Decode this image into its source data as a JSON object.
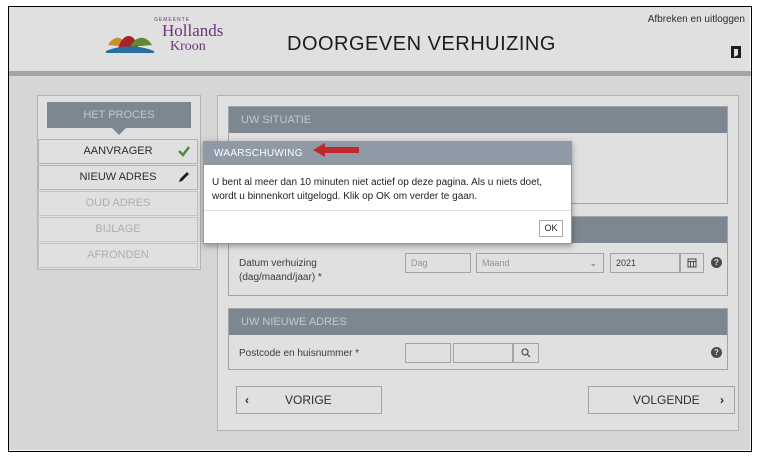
{
  "header": {
    "logo_top": "GEMEENTE",
    "logo_line1": "Hollands",
    "logo_line2": "Kroon",
    "title": "DOORGEVEN VERHUIZING",
    "logout": "Afbreken en uitloggen",
    "logout_icon": "door-exit-icon"
  },
  "sidebar": {
    "heading": "HET PROCES",
    "steps": [
      {
        "label": "AANVRAGER",
        "state": "done",
        "icon": "check-icon"
      },
      {
        "label": "NIEUW ADRES",
        "state": "active",
        "icon": "pencil-icon"
      },
      {
        "label": "OUD ADRES",
        "state": "disabled"
      },
      {
        "label": "BIJLAGE",
        "state": "disabled"
      },
      {
        "label": "AFRONDEN",
        "state": "disabled"
      }
    ]
  },
  "main": {
    "situatie_heading": "UW SITUATIE",
    "date_label": "Datum verhuizing (dag/maand/jaar) *",
    "day_placeholder": "Dag",
    "month_placeholder": "Maand",
    "year_value": "2021",
    "nieuwe_adres_heading": "UW NIEUWE ADRES",
    "postcode_label": "Postcode en huisnummer *",
    "prev_label": "VORIGE",
    "next_label": "VOLGENDE"
  },
  "modal": {
    "title": "WAARSCHUWING",
    "message": "U bent al meer dan 10 minuten niet actief op deze pagina. Als u niets doet, wordt u binnenkort uitgelogd. Klik op OK om verder te gaan.",
    "ok_label": "OK"
  },
  "colors": {
    "panel_header": "#8f9aa6",
    "accent_red": "#c0282d",
    "check_green": "#5aa23a",
    "brand_purple": "#7a3b8f"
  }
}
